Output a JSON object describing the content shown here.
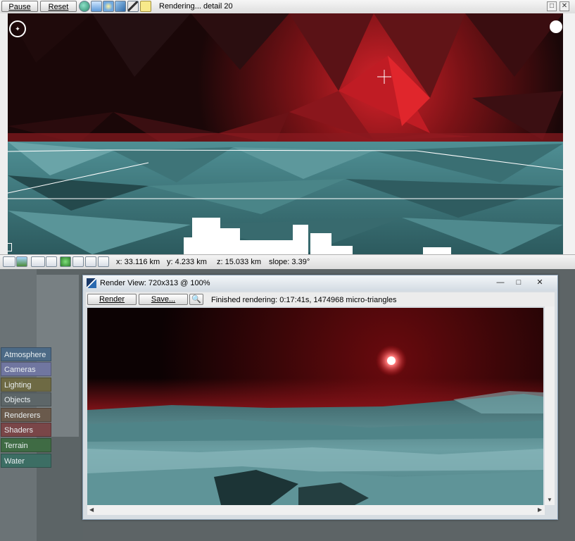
{
  "toolbar": {
    "pause_label": "Pause",
    "reset_label": "Reset",
    "status": "Rendering... detail 20",
    "icons": [
      "globe-icon",
      "cloud-icon",
      "sun-icon",
      "export-icon",
      "brush-icon",
      "note-icon"
    ]
  },
  "viewport": {
    "compass_icon": "compass-icon",
    "sun_position_icon": "sun-position-icon"
  },
  "coords": {
    "x": "x: 33.116 km",
    "y": "y: 4.233 km",
    "z": "z: 15.033 km",
    "slope": "slope: 3.39°"
  },
  "categories": [
    {
      "label": "Atmosphere",
      "color": "#4c6a86"
    },
    {
      "label": "Cameras",
      "color": "#7076a0"
    },
    {
      "label": "Lighting",
      "color": "#6e6a44"
    },
    {
      "label": "Objects",
      "color": "#5d6668"
    },
    {
      "label": "Renderers",
      "color": "#6a5a4c"
    },
    {
      "label": "Shaders",
      "color": "#7a4648"
    },
    {
      "label": "Terrain",
      "color": "#3f6b44"
    },
    {
      "label": "Water",
      "color": "#3c6e64"
    }
  ],
  "render_window": {
    "title": "Render View: 720x313 @ 100%",
    "render_label": "Render",
    "save_label": "Save...",
    "status": "Finished rendering:  0:17:41s, 1474968 micro-triangles",
    "minimize": "—",
    "maximize": "□",
    "close": "✕"
  },
  "colors": {
    "accent_red": "#e0262c",
    "terrain_teal": "#5f9aa0"
  }
}
